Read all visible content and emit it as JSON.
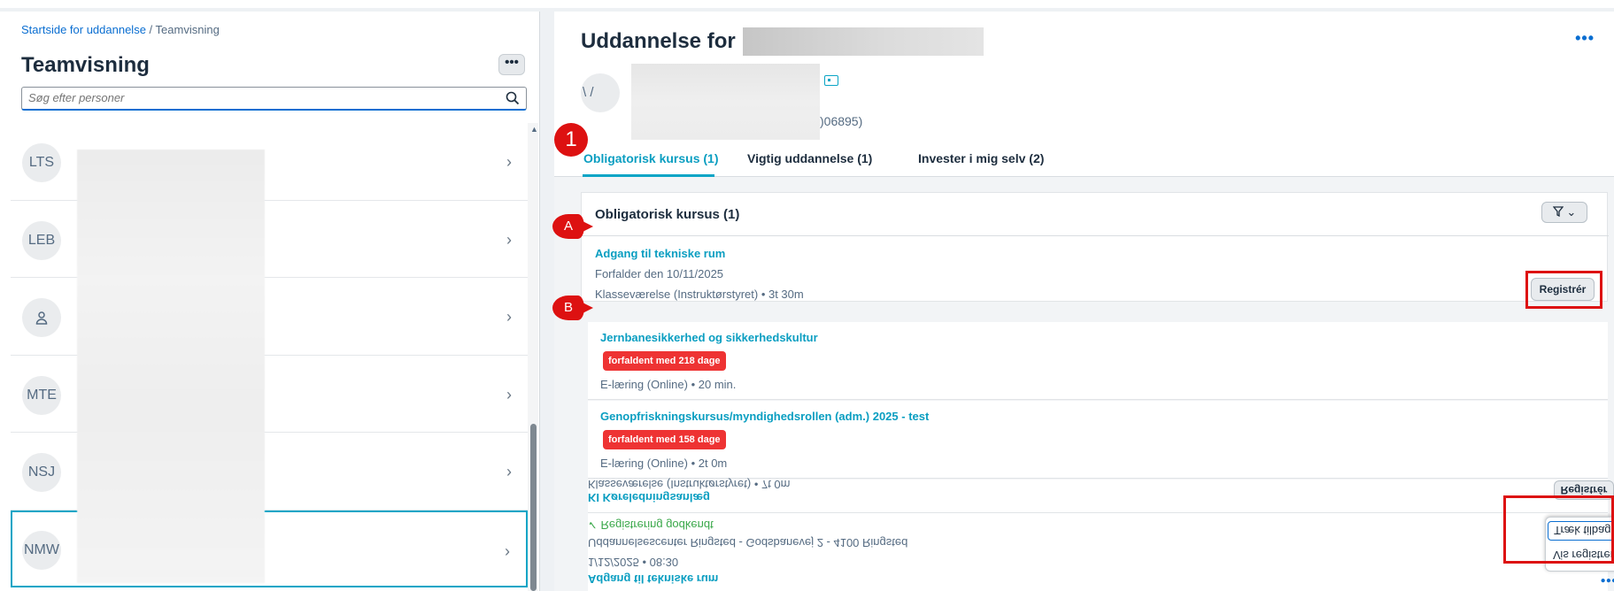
{
  "left": {
    "breadcrumb": {
      "link": "Startside for uddannelse",
      "sep": " / ",
      "current": "Teamvisning"
    },
    "title": "Teamvisning",
    "more": "•••",
    "search_placeholder": "Søg efter personer",
    "people": [
      {
        "initials": "LTS"
      },
      {
        "initials": "LEB"
      },
      {
        "initials": "person-icon"
      },
      {
        "initials": "MTE"
      },
      {
        "initials": "NSJ"
      },
      {
        "initials": "NMW"
      }
    ],
    "chevron": "›"
  },
  "right": {
    "title": "Uddannelse for",
    "more": "•••",
    "avatar_partial": "\\ /",
    "employee_id_partial": ")06895)",
    "tabs": [
      {
        "label": "Obligatorisk kursus (1)"
      },
      {
        "label": "Vigtig uddannelse (1)"
      },
      {
        "label": "Invester i mig selv (2)"
      }
    ],
    "section": {
      "title": "Obligatorisk kursus (1)",
      "filter_chevron": "⌄",
      "course": {
        "title": "Adgang til tekniske rum",
        "due": "Forfalder den 10/11/2025",
        "meta": "Klasseværelse (Instruktørstyret) • 3t 30m",
        "register": "Registrér"
      }
    },
    "overdue": [
      {
        "title": "Jernbanesikkerhed og sikkerhedskultur",
        "tag": "forfaldent med 218 dage",
        "meta": "E-læring (Online) • 20 min."
      },
      {
        "title": "Genopfriskningskursus/myndighedsrollen (adm.) 2025 - test",
        "tag": "forfaldent med 158 dage",
        "meta": "E-læring (Online) • 2t 0m"
      }
    ],
    "flipped": {
      "title1": "KI Køreledningsanlæg",
      "meta1": "Klasseværelse (Instruktørstyret) • 7t 0m",
      "register": "Registrér",
      "approved": "✓ Registrering godkendt",
      "location": "Uddannelsescenter Ringsted - Godsbanevej 2 - 4100 Ringsted",
      "date": "1/12/2025 • 08:30",
      "title2": "Adgang til tekniske rum",
      "more": "•••",
      "menu": {
        "item_view": "Vis registrering",
        "item_withdraw": "Træk tilbage"
      }
    }
  },
  "annotations": {
    "one": "1",
    "a": "A",
    "b": "B"
  }
}
